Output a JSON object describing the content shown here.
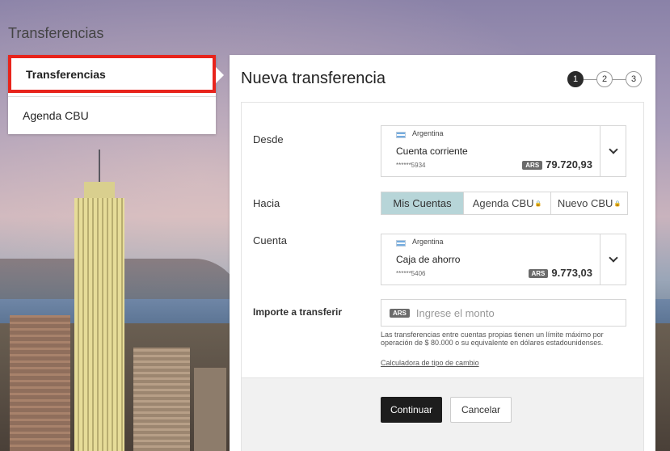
{
  "page": {
    "title": "Transferencias"
  },
  "sidebar": {
    "items": [
      {
        "label": "Transferencias",
        "active": true
      },
      {
        "label": "Agenda CBU",
        "active": false
      }
    ]
  },
  "main": {
    "title": "Nueva transferencia",
    "steps": [
      "1",
      "2",
      "3"
    ],
    "current_step": 1,
    "desde": {
      "label": "Desde",
      "country": "Argentina",
      "account_type": "Cuenta corriente",
      "account_number": "******5934",
      "currency": "ARS",
      "balance": "79.720,93"
    },
    "hacia": {
      "label": "Hacia",
      "options": [
        "Mis Cuentas",
        "Agenda CBU",
        "Nuevo CBU"
      ],
      "selected": "Mis Cuentas",
      "lock_glyph": "🔒"
    },
    "cuenta": {
      "label": "Cuenta",
      "country": "Argentina",
      "account_type": "Caja de ahorro",
      "account_number": "******5406",
      "currency": "ARS",
      "balance": "9.773,03"
    },
    "importe": {
      "label": "Importe a transferir",
      "currency": "ARS",
      "placeholder": "Ingrese el monto",
      "note": "Las transferencias entre cuentas propias tienen un límite máximo por operación de $ 80.000 o su equivalente en dólares estadounidenses.",
      "calc_link": "Calculadora de tipo de cambio"
    },
    "buttons": {
      "continue": "Continuar",
      "cancel": "Cancelar"
    }
  },
  "colors": {
    "accent_red": "#e8241c",
    "segment_active": "#b7d5d8",
    "primary_button": "#1d1d1d"
  }
}
